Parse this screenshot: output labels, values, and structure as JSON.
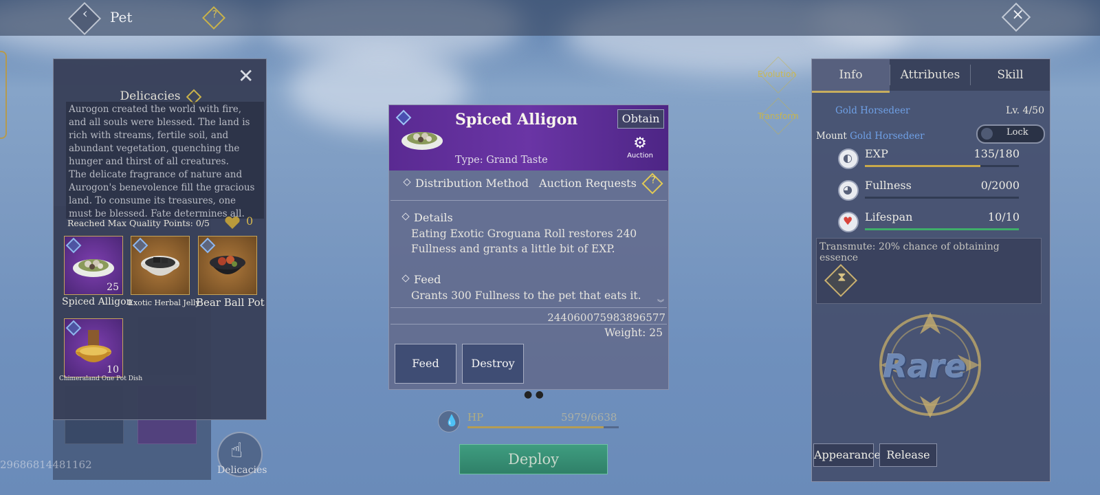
{
  "header": {
    "title": "Pet",
    "help_icon": "question-icon",
    "back_icon": "back-chevron-icon",
    "close_icon": "close-x-icon"
  },
  "background": {
    "id_text": "29686814481162",
    "delicacies_label": "Delicacies"
  },
  "delicacies_popup": {
    "title": "Delicacies",
    "lore": "Aurogon created the world with fire, and all souls were blessed. The land is rich with streams, fertile soil, and abundant vegetation, quenching the hunger and thirst of all creatures.\nThe delicate fragrance of nature and Aurogon's benevolence fill the gracious land. To consume its treasures, one must be blessed. Fate determines all.",
    "quality_points": "Reached Max Quality Points: 0/5",
    "heart_count": "0",
    "items": [
      {
        "name": "Spiced Alligon",
        "count": "25",
        "rarity": "purple"
      },
      {
        "name": "Exotic Herbal Jelly",
        "count": "",
        "rarity": "orange"
      },
      {
        "name": "Bear Ball Pot",
        "count": "",
        "rarity": "orange"
      },
      {
        "name": "Chimeraland One Pot Dish",
        "count": "10",
        "rarity": "purple"
      }
    ]
  },
  "item_detail": {
    "name": "Spiced Alligon",
    "type": "Type: Grand Taste",
    "obtain_label": "Obtain",
    "auction_label": "Auction",
    "distribution_label": "Distribution Method",
    "distribution_value": "Auction Requests",
    "details_title": "Details",
    "details_text": "Eating Exotic Groguana Roll restores 240 Fullness and grants a little bit of EXP.",
    "feed_title": "Feed",
    "feed_text": "Grants 300 Fullness to the pet that eats it.",
    "serial": "244060075983896577",
    "weight": "Weight: 25",
    "feed_button": "Feed",
    "destroy_button": "Destroy"
  },
  "pet_status": {
    "hp_label": "HP",
    "hp_value": "5979/6638",
    "hp_fraction": 0.9,
    "deploy_label": "Deploy"
  },
  "side_links": {
    "evolution": "Evolution",
    "transform": "Transform"
  },
  "right_panel": {
    "tabs": [
      "Info",
      "Attributes",
      "Skill"
    ],
    "active_tab": "Info",
    "pet_name": "Gold Horsedeer",
    "level": "Lv. 4/50",
    "mount_label": "Mount",
    "mount_name": "Gold Horsedeer",
    "lock_label": "Lock",
    "stats": [
      {
        "name": "EXP",
        "value": "135/180",
        "fraction": 0.75,
        "color": "#c9a94a"
      },
      {
        "name": "Fullness",
        "value": "0/2000",
        "fraction": 0,
        "color": "#c9a94a"
      },
      {
        "name": "Lifespan",
        "value": "10/10",
        "fraction": 1,
        "color": "#3fae6a"
      }
    ],
    "transmute_text": "Transmute: 20% chance of obtaining essence",
    "rarity_label": "Rare",
    "appearance_button": "Appearance",
    "release_button": "Release"
  }
}
